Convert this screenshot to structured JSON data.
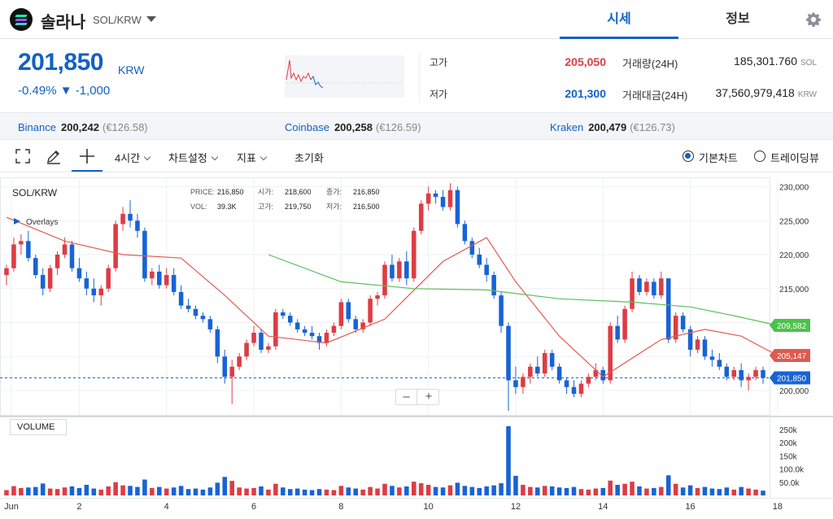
{
  "header": {
    "coin_name": "솔라나",
    "pair": "SOL/KRW",
    "tabs": [
      "시세",
      "정보"
    ]
  },
  "summary": {
    "price": "201,850",
    "currency": "KRW",
    "change": "-0.49% ▼ -1,000",
    "high_label": "고가",
    "high": "205,050",
    "low_label": "저가",
    "low": "201,300",
    "volume_label": "거래량(24H)",
    "volume": "185,301.760",
    "volume_unit": "SOL",
    "value_label": "거래대금(24H)",
    "value": "37,560,979,418",
    "value_unit": "KRW"
  },
  "exchanges": [
    {
      "name": "Binance",
      "price": "200,242",
      "eur": "(€126.58)"
    },
    {
      "name": "Coinbase",
      "price": "200,258",
      "eur": "(€126.59)"
    },
    {
      "name": "Kraken",
      "price": "200,479",
      "eur": "(€126.73)"
    }
  ],
  "toolbar": {
    "interval": "4시간",
    "chart_settings": "차트설정",
    "indicators": "지표",
    "reset": "초기화",
    "radio_basic": "기본차트",
    "radio_tradingview": "트레이딩뷰",
    "selected": "기본차트"
  },
  "legend": {
    "symbol": "SOL/KRW",
    "overlays": "Overlays",
    "price_label": "PRICE:",
    "price": "216,850",
    "open_label": "시가:",
    "open": "218,600",
    "close_label": "종가:",
    "close": "216,850",
    "vol_label": "VOL:",
    "vol": "39.3K",
    "high_label": "고가:",
    "high": "219,750",
    "low_label": "저가:",
    "low": "216,500"
  },
  "volume_label": "VOLUME",
  "colors": {
    "accent": "#1261c4",
    "up": "#dd3c44",
    "down": "#1763d6",
    "ma_short": "#e35b4f",
    "ma_long": "#5dbf5d"
  },
  "chart_data": {
    "type": "candlestick",
    "y_ticks": [
      "230,000",
      "225,000",
      "220,000",
      "215,000",
      "210,000",
      "205,000",
      "200,000"
    ],
    "y_tick_values": [
      230000,
      225000,
      220000,
      215000,
      210000,
      205000,
      200000
    ],
    "ylim": [
      198000,
      230500
    ],
    "x_ticks": [
      "Jun",
      "2",
      "4",
      "6",
      "8",
      "10",
      "12",
      "14",
      "16",
      "18"
    ],
    "vol_ticks": [
      "250k",
      "200k",
      "150k",
      "100.0k",
      "50.0k"
    ],
    "vol_tick_values": [
      250000,
      200000,
      150000,
      100000,
      50000
    ],
    "vol_max": 280000,
    "price_labels": [
      {
        "text": "209,582",
        "value": 209582,
        "color": "#4cc24c"
      },
      {
        "text": "205,147",
        "value": 205147,
        "color": "#dd5b4f"
      },
      {
        "text": "201,850",
        "value": 201850,
        "color": "#1763d6"
      }
    ],
    "current_price": 201850,
    "candles": [
      [
        217000,
        218500,
        215500,
        218000,
        20000
      ],
      [
        218000,
        222500,
        217500,
        221500,
        35000
      ],
      [
        221500,
        223000,
        220000,
        222000,
        28000
      ],
      [
        222000,
        223500,
        219000,
        219500,
        30000
      ],
      [
        219500,
        220000,
        216500,
        217000,
        32000
      ],
      [
        217000,
        218000,
        214000,
        215000,
        45000
      ],
      [
        215000,
        218500,
        214500,
        218000,
        26000
      ],
      [
        218000,
        220500,
        217000,
        220000,
        24000
      ],
      [
        220000,
        222500,
        219500,
        221500,
        30000
      ],
      [
        221500,
        222000,
        217500,
        218000,
        34000
      ],
      [
        218000,
        219500,
        216000,
        216500,
        28000
      ],
      [
        216500,
        217500,
        214000,
        215000,
        40000
      ],
      [
        215000,
        216500,
        213000,
        214000,
        26000
      ],
      [
        214000,
        215500,
        212500,
        215000,
        22000
      ],
      [
        215000,
        218500,
        214500,
        218000,
        34000
      ],
      [
        218000,
        225000,
        217500,
        224500,
        50000
      ],
      [
        224500,
        227000,
        223500,
        226000,
        38000
      ],
      [
        226000,
        228000,
        224000,
        225000,
        36000
      ],
      [
        225000,
        226000,
        222500,
        223500,
        32000
      ],
      [
        223500,
        224000,
        216000,
        216500,
        60000
      ],
      [
        216500,
        218000,
        215500,
        217500,
        28000
      ],
      [
        217500,
        218500,
        215000,
        215500,
        32000
      ],
      [
        215500,
        218000,
        215000,
        217000,
        26000
      ],
      [
        217000,
        218000,
        214000,
        214500,
        30000
      ],
      [
        214500,
        215500,
        212000,
        212500,
        36000
      ],
      [
        212500,
        213500,
        211500,
        212000,
        24000
      ],
      [
        212000,
        212500,
        210500,
        211000,
        26000
      ],
      [
        211000,
        211500,
        210000,
        210500,
        22000
      ],
      [
        210500,
        211000,
        208500,
        209000,
        30000
      ],
      [
        209000,
        209500,
        204000,
        205000,
        48000
      ],
      [
        205000,
        206000,
        201000,
        202000,
        70000
      ],
      [
        202000,
        204500,
        198000,
        203500,
        55000
      ],
      [
        203500,
        205500,
        203000,
        205000,
        30000
      ],
      [
        205000,
        207500,
        204500,
        207000,
        26000
      ],
      [
        207000,
        209500,
        206500,
        208500,
        28000
      ],
      [
        208500,
        209000,
        205500,
        206000,
        34000
      ],
      [
        206000,
        207000,
        205500,
        206500,
        22000
      ],
      [
        206500,
        212000,
        206000,
        211500,
        44000
      ],
      [
        211500,
        212000,
        210500,
        211000,
        30000
      ],
      [
        211000,
        211500,
        209500,
        210000,
        24000
      ],
      [
        210000,
        210500,
        208500,
        209000,
        26000
      ],
      [
        209000,
        209500,
        208000,
        208500,
        22000
      ],
      [
        208500,
        209500,
        207500,
        208000,
        20000
      ],
      [
        208000,
        208500,
        206000,
        207000,
        24000
      ],
      [
        207000,
        209000,
        206500,
        208500,
        22000
      ],
      [
        208500,
        210000,
        208000,
        209500,
        20000
      ],
      [
        209500,
        213500,
        209000,
        213000,
        36000
      ],
      [
        213000,
        213500,
        210000,
        210500,
        30000
      ],
      [
        210500,
        211000,
        208500,
        209000,
        26000
      ],
      [
        209000,
        210500,
        208500,
        210000,
        22000
      ],
      [
        210000,
        214000,
        209500,
        213500,
        32000
      ],
      [
        213500,
        214500,
        212500,
        214000,
        26000
      ],
      [
        214000,
        219000,
        213500,
        218500,
        44000
      ],
      [
        218500,
        220000,
        216000,
        216500,
        36000
      ],
      [
        216500,
        219500,
        216000,
        219000,
        30000
      ],
      [
        219000,
        220500,
        215500,
        216500,
        34000
      ],
      [
        216500,
        224000,
        216000,
        223500,
        52000
      ],
      [
        223500,
        228000,
        223000,
        227500,
        46000
      ],
      [
        227500,
        230000,
        226500,
        229000,
        40000
      ],
      [
        229000,
        229500,
        227500,
        228500,
        32000
      ],
      [
        228500,
        229500,
        226500,
        227000,
        30000
      ],
      [
        227000,
        230500,
        226500,
        229500,
        38000
      ],
      [
        229500,
        230000,
        224000,
        224500,
        48000
      ],
      [
        224500,
        225000,
        221500,
        222000,
        36000
      ],
      [
        222000,
        222500,
        219500,
        220000,
        32000
      ],
      [
        220000,
        221000,
        218000,
        218500,
        28000
      ],
      [
        218500,
        219500,
        216000,
        217000,
        34000
      ],
      [
        217000,
        217500,
        213500,
        214000,
        38000
      ],
      [
        214000,
        214500,
        208500,
        209500,
        46000
      ],
      [
        209500,
        210000,
        197000,
        201500,
        262000
      ],
      [
        201500,
        203500,
        199500,
        200500,
        74000
      ],
      [
        200500,
        202500,
        199500,
        202000,
        40000
      ],
      [
        202000,
        204000,
        201000,
        203500,
        32000
      ],
      [
        203500,
        205000,
        202000,
        202500,
        30000
      ],
      [
        202500,
        206000,
        202000,
        205500,
        36000
      ],
      [
        205500,
        206000,
        203000,
        203500,
        34000
      ],
      [
        203500,
        204000,
        201000,
        201500,
        30000
      ],
      [
        201500,
        202000,
        199500,
        200500,
        28000
      ],
      [
        200500,
        201500,
        199000,
        199500,
        32000
      ],
      [
        199500,
        201500,
        199000,
        201000,
        24000
      ],
      [
        201000,
        202500,
        200500,
        202000,
        22000
      ],
      [
        202000,
        204000,
        201500,
        203000,
        26000
      ],
      [
        203000,
        203500,
        201000,
        201500,
        28000
      ],
      [
        201500,
        210000,
        201000,
        209500,
        56000
      ],
      [
        209500,
        211000,
        207000,
        207500,
        40000
      ],
      [
        207500,
        212500,
        207000,
        212000,
        44000
      ],
      [
        212000,
        217500,
        211500,
        216500,
        52000
      ],
      [
        216500,
        217000,
        214000,
        214500,
        34000
      ],
      [
        214500,
        216500,
        214000,
        216000,
        26000
      ],
      [
        216000,
        216500,
        213500,
        214000,
        28000
      ],
      [
        214000,
        217500,
        213500,
        216500,
        32000
      ],
      [
        216500,
        216500,
        207000,
        207500,
        76000
      ],
      [
        207500,
        211500,
        207000,
        211000,
        44000
      ],
      [
        211000,
        211500,
        208500,
        209000,
        30000
      ],
      [
        209000,
        209500,
        205000,
        206000,
        38000
      ],
      [
        206000,
        208000,
        205500,
        207500,
        28000
      ],
      [
        207500,
        208000,
        204500,
        205000,
        32000
      ],
      [
        205000,
        206000,
        203500,
        204500,
        26000
      ],
      [
        204500,
        205500,
        203000,
        203500,
        24000
      ],
      [
        203500,
        204000,
        201500,
        202000,
        30000
      ],
      [
        202000,
        203500,
        201500,
        203000,
        22000
      ],
      [
        203000,
        204000,
        200500,
        201500,
        32000
      ],
      [
        201500,
        202500,
        200000,
        202000,
        26000
      ],
      [
        202000,
        203500,
        201500,
        203000,
        22000
      ],
      [
        203000,
        203500,
        201000,
        201850,
        18000
      ]
    ],
    "ma_short": [
      [
        0,
        225500
      ],
      [
        8,
        222000
      ],
      [
        16,
        220000
      ],
      [
        24,
        219500
      ],
      [
        30,
        214000
      ],
      [
        36,
        208000
      ],
      [
        44,
        207000
      ],
      [
        52,
        210500
      ],
      [
        60,
        219000
      ],
      [
        66,
        222500
      ],
      [
        70,
        216000
      ],
      [
        76,
        208000
      ],
      [
        82,
        202000
      ],
      [
        90,
        207500
      ],
      [
        96,
        209000
      ],
      [
        101,
        208000
      ],
      [
        106,
        205147
      ]
    ],
    "ma_long": [
      [
        36,
        220000
      ],
      [
        46,
        216000
      ],
      [
        56,
        215000
      ],
      [
        66,
        214800
      ],
      [
        76,
        213500
      ],
      [
        86,
        213000
      ],
      [
        94,
        212300
      ],
      [
        100,
        211000
      ],
      [
        106,
        209582
      ]
    ]
  }
}
